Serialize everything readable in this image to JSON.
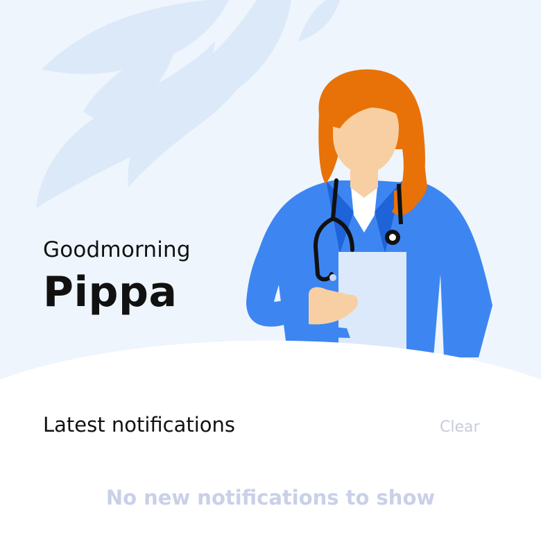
{
  "header": {
    "greeting": "Goodmorning",
    "user_name": "Pippa"
  },
  "notifications": {
    "title": "Latest notifications",
    "clear_label": "Clear",
    "empty_message": "No new notifications to show"
  },
  "illustration": {
    "subject": "doctor-with-stethoscope-and-clipboard",
    "background": "leaf-pattern"
  },
  "colors": {
    "hero_background": "#eef5fc",
    "leaf": "#dce9f8",
    "coat": "#3d86f2",
    "coat_dark": "#1f63d8",
    "hair": "#e87208",
    "skin": "#f7cfa2",
    "clipboard": "#dce9fa",
    "muted_text": "#c7cbdc",
    "empty_text": "#c9d0e8"
  }
}
